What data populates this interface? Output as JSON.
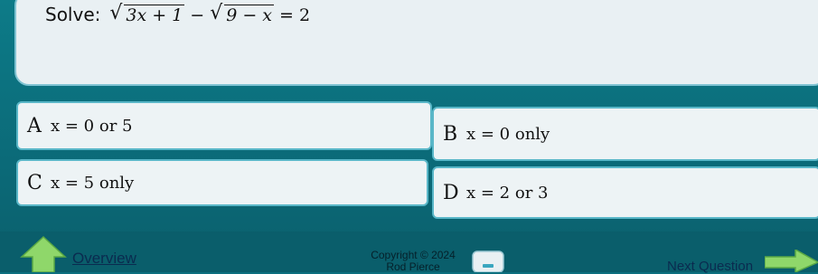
{
  "question": {
    "prefix": "Solve:",
    "expr": {
      "radicand1": "3x + 1",
      "operator": "−",
      "radicand2": "9 − x",
      "equals": "=",
      "rhs": "2"
    }
  },
  "answers": [
    {
      "letter": "A",
      "text": "x = 0 or 5"
    },
    {
      "letter": "B",
      "text": "x = 0 only"
    },
    {
      "letter": "C",
      "text": "x = 5 only"
    },
    {
      "letter": "D",
      "text": "x = 2 or 3"
    }
  ],
  "footer": {
    "overview_label": "Overview",
    "copyright_line1": "Copyright © 2024",
    "copyright_line2": "Rod Pierce",
    "next_label": "Next Question"
  },
  "icons": {
    "home": "up-arrow-icon",
    "controls": "keyboard-icon",
    "next": "right-arrow-icon"
  },
  "colors": {
    "background": "#0c6f7e",
    "panel": "#e9f0f3",
    "accent_border": "#5ab7c8",
    "arrow_green": "#8fd76a"
  }
}
